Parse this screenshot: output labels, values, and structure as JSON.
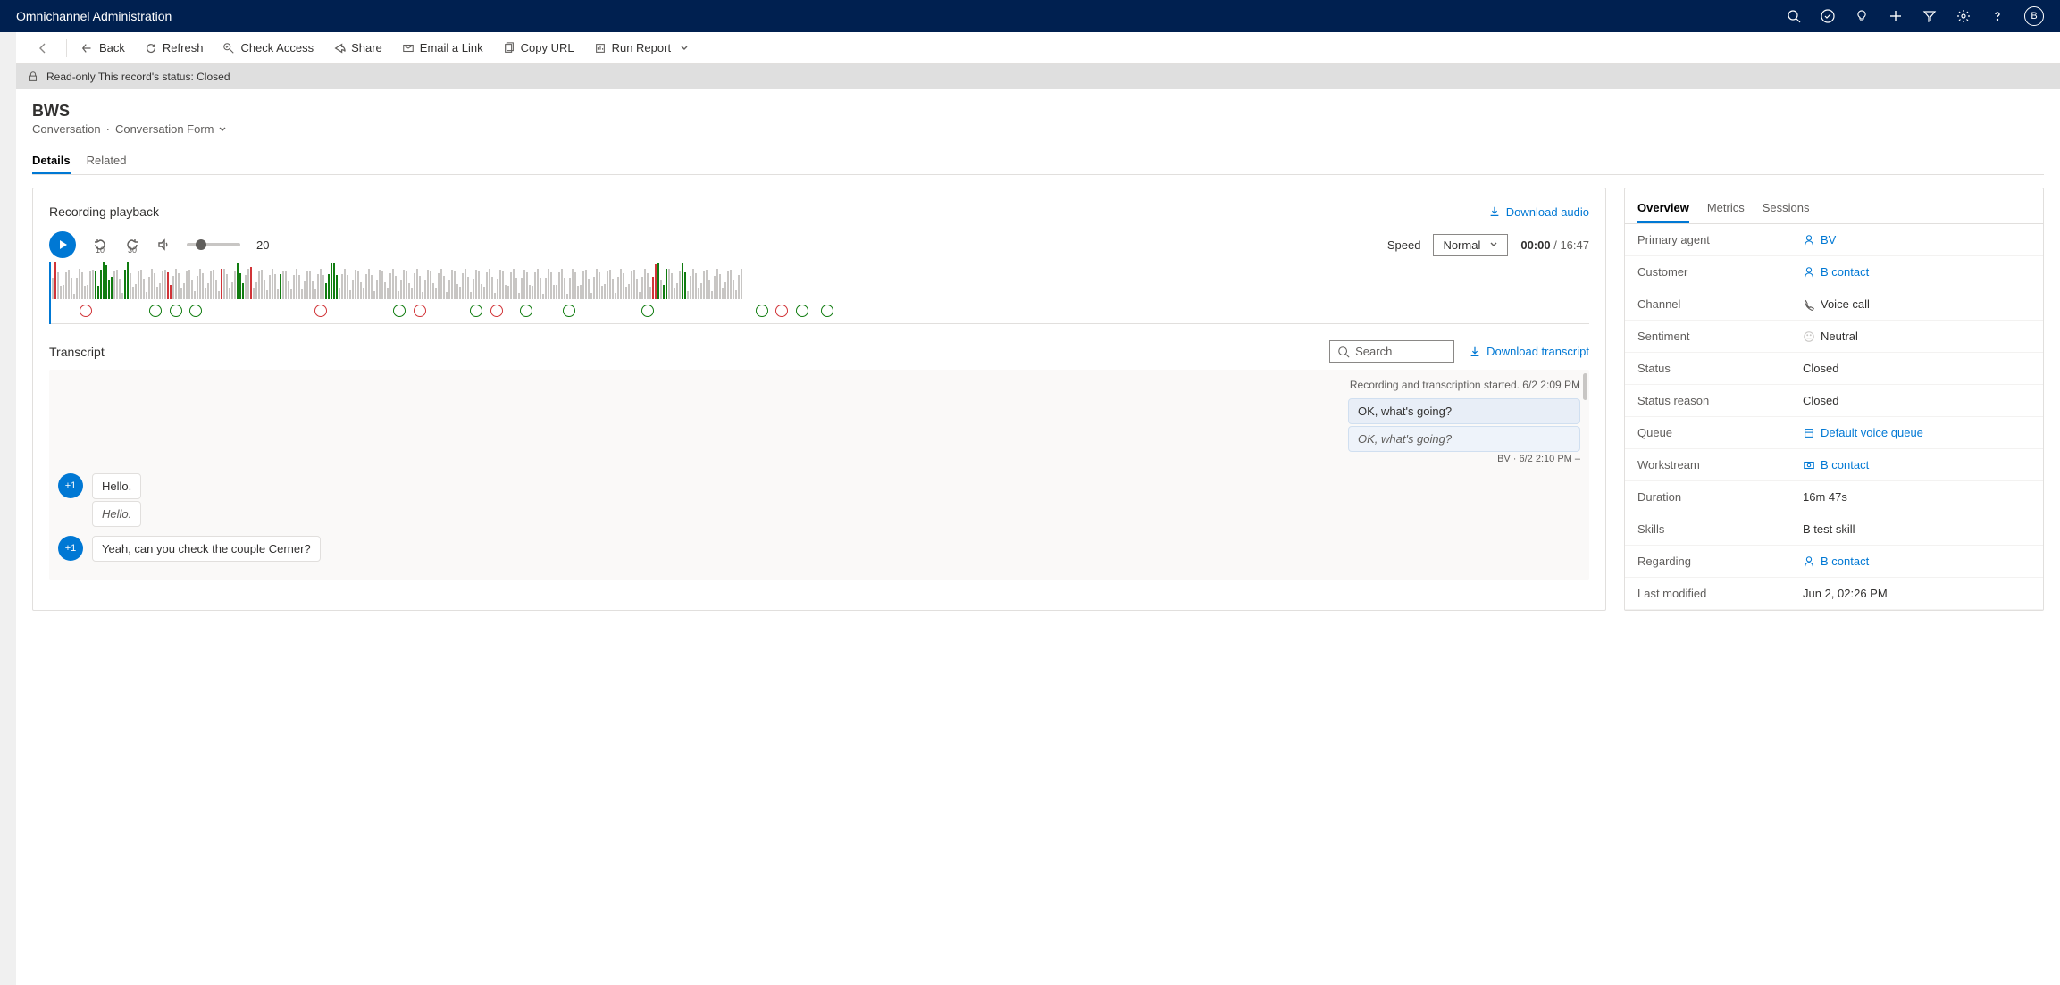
{
  "app_title": "Omnichannel Administration",
  "commands": {
    "back": "Back",
    "refresh": "Refresh",
    "check_access": "Check Access",
    "share": "Share",
    "email_link": "Email a Link",
    "copy_url": "Copy URL",
    "run_report": "Run Report"
  },
  "notice": "Read-only  This record's status: Closed",
  "record": {
    "title": "BWS",
    "entity": "Conversation",
    "form": "Conversation Form"
  },
  "tabs": {
    "details": "Details",
    "related": "Related"
  },
  "playback": {
    "title": "Recording playback",
    "download": "Download audio",
    "volume": "20",
    "speed_label": "Speed",
    "speed_value": "Normal",
    "time_current": "00:00",
    "time_total": "16:47"
  },
  "transcript": {
    "title": "Transcript",
    "search_placeholder": "Search",
    "download": "Download transcript",
    "system_msg": "Recording and transcription started. 6/2 2:09 PM",
    "agent_msg1": "OK, what's going?",
    "agent_msg1_tr": "OK, what's going?",
    "agent_meta": "BV   · 6/2 2:10 PM   –",
    "cust_avatar": "+1",
    "cust_msg1": "Hello.",
    "cust_msg1_tr": "Hello.",
    "cust_msg2": "Yeah, can you check the couple Cerner?"
  },
  "side": {
    "tabs": {
      "overview": "Overview",
      "metrics": "Metrics",
      "sessions": "Sessions"
    },
    "rows": {
      "primary_agent": {
        "k": "Primary agent",
        "v": "BV"
      },
      "customer": {
        "k": "Customer",
        "v": "B contact"
      },
      "channel": {
        "k": "Channel",
        "v": "Voice call"
      },
      "sentiment": {
        "k": "Sentiment",
        "v": "Neutral"
      },
      "status": {
        "k": "Status",
        "v": "Closed"
      },
      "status_reason": {
        "k": "Status reason",
        "v": "Closed"
      },
      "queue": {
        "k": "Queue",
        "v": "Default voice queue"
      },
      "workstream": {
        "k": "Workstream",
        "v": "B contact"
      },
      "duration": {
        "k": "Duration",
        "v": "16m 47s"
      },
      "skills": {
        "k": "Skills",
        "v": "B test skill"
      },
      "regarding": {
        "k": "Regarding",
        "v": "B contact"
      },
      "last_modified": {
        "k": "Last modified",
        "v": "Jun 2, 02:26 PM"
      }
    }
  }
}
